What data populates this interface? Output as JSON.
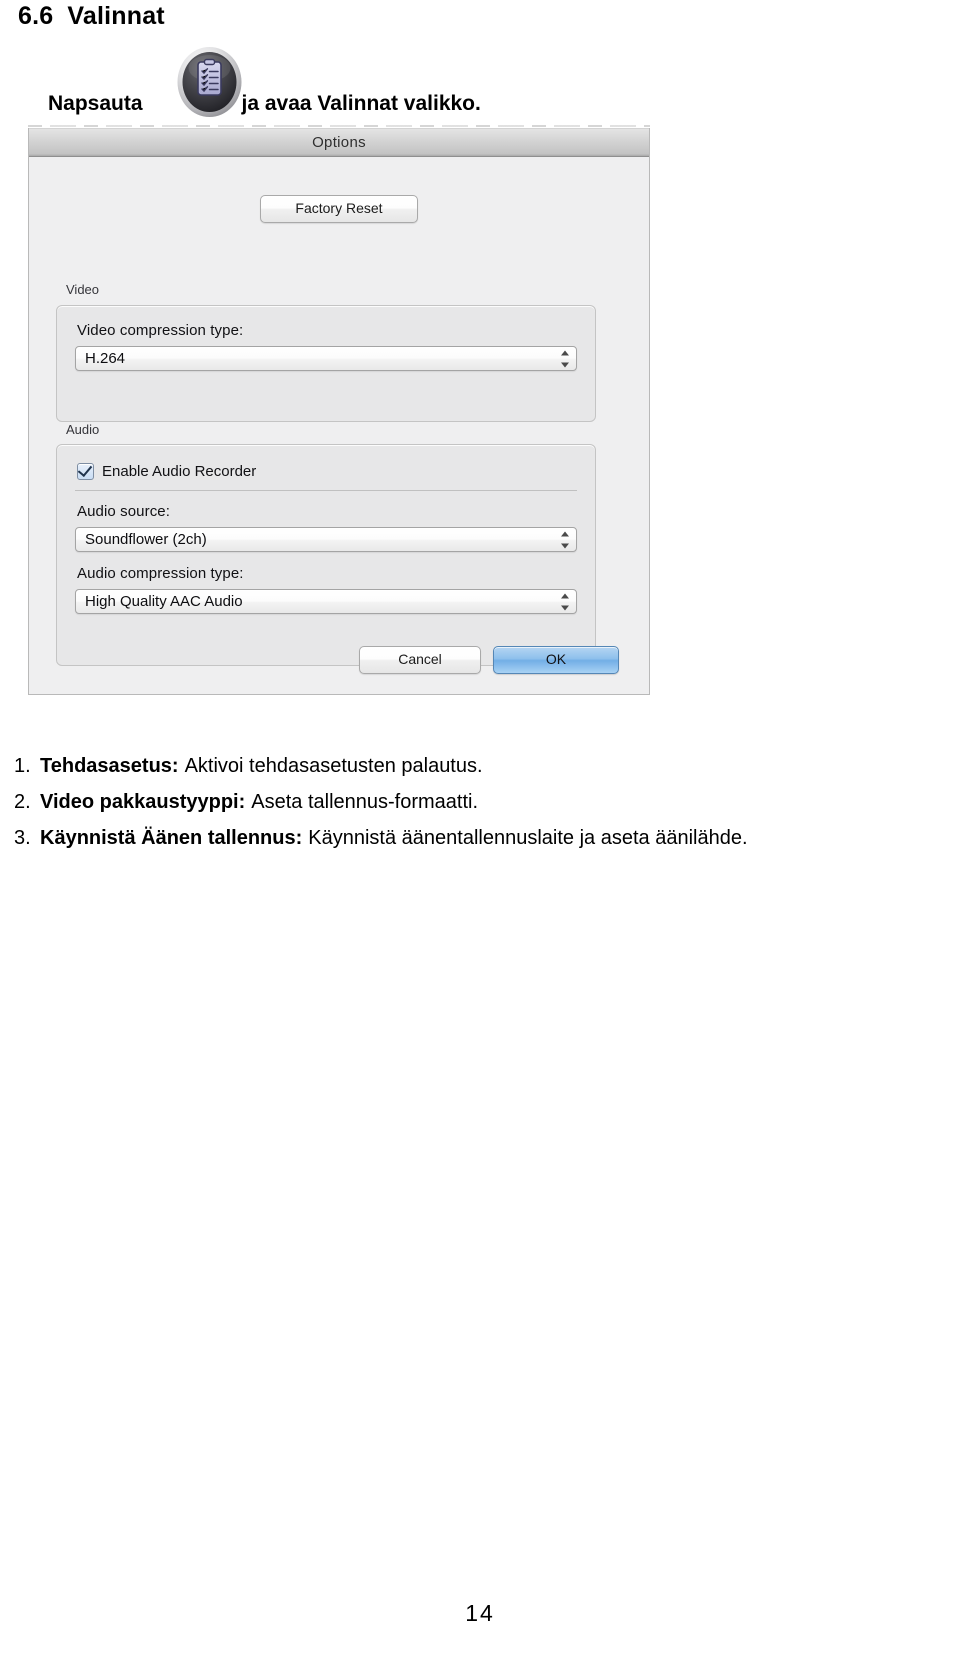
{
  "document": {
    "section_number": "6.6",
    "section_title": "Valinnat",
    "page_number": "14"
  },
  "instruction": {
    "before_icon": "Napsauta",
    "icon_name": "options-clipboard-icon",
    "after_icon": "ja avaa Valinnat valikko."
  },
  "dialog": {
    "title": "Options",
    "factory_reset_label": "Factory Reset",
    "video": {
      "group_label": "Video",
      "compression_label": "Video compression type:",
      "compression_value": "H.264"
    },
    "audio": {
      "group_label": "Audio",
      "enable_recorder_label": "Enable Audio Recorder",
      "enable_recorder_checked": "checked",
      "source_label": "Audio source:",
      "source_value": "Soundflower (2ch)",
      "compression_label": "Audio compression type:",
      "compression_value": "High Quality AAC Audio"
    },
    "footer": {
      "cancel_label": "Cancel",
      "ok_label": "OK"
    },
    "colors": {
      "accent_ok_button": "#72aee6",
      "dialog_background": "#efeff0",
      "group_background": "#e7e7e8",
      "titlebar_top": "#e4e4e4",
      "titlebar_bottom": "#a9a9a9"
    }
  },
  "steps": [
    {
      "number": "1.",
      "term": "Tehdasasetus:",
      "description": "Aktivoi tehdasasetusten palautus."
    },
    {
      "number": "2.",
      "term": "Video pakkaustyyppi:",
      "description": "Aseta tallennus-formaatti."
    },
    {
      "number": "3.",
      "term": "Käynnistä Äänen tallennus:",
      "description": "Käynnistä äänentallennuslaite ja aseta äänilähde."
    }
  ]
}
